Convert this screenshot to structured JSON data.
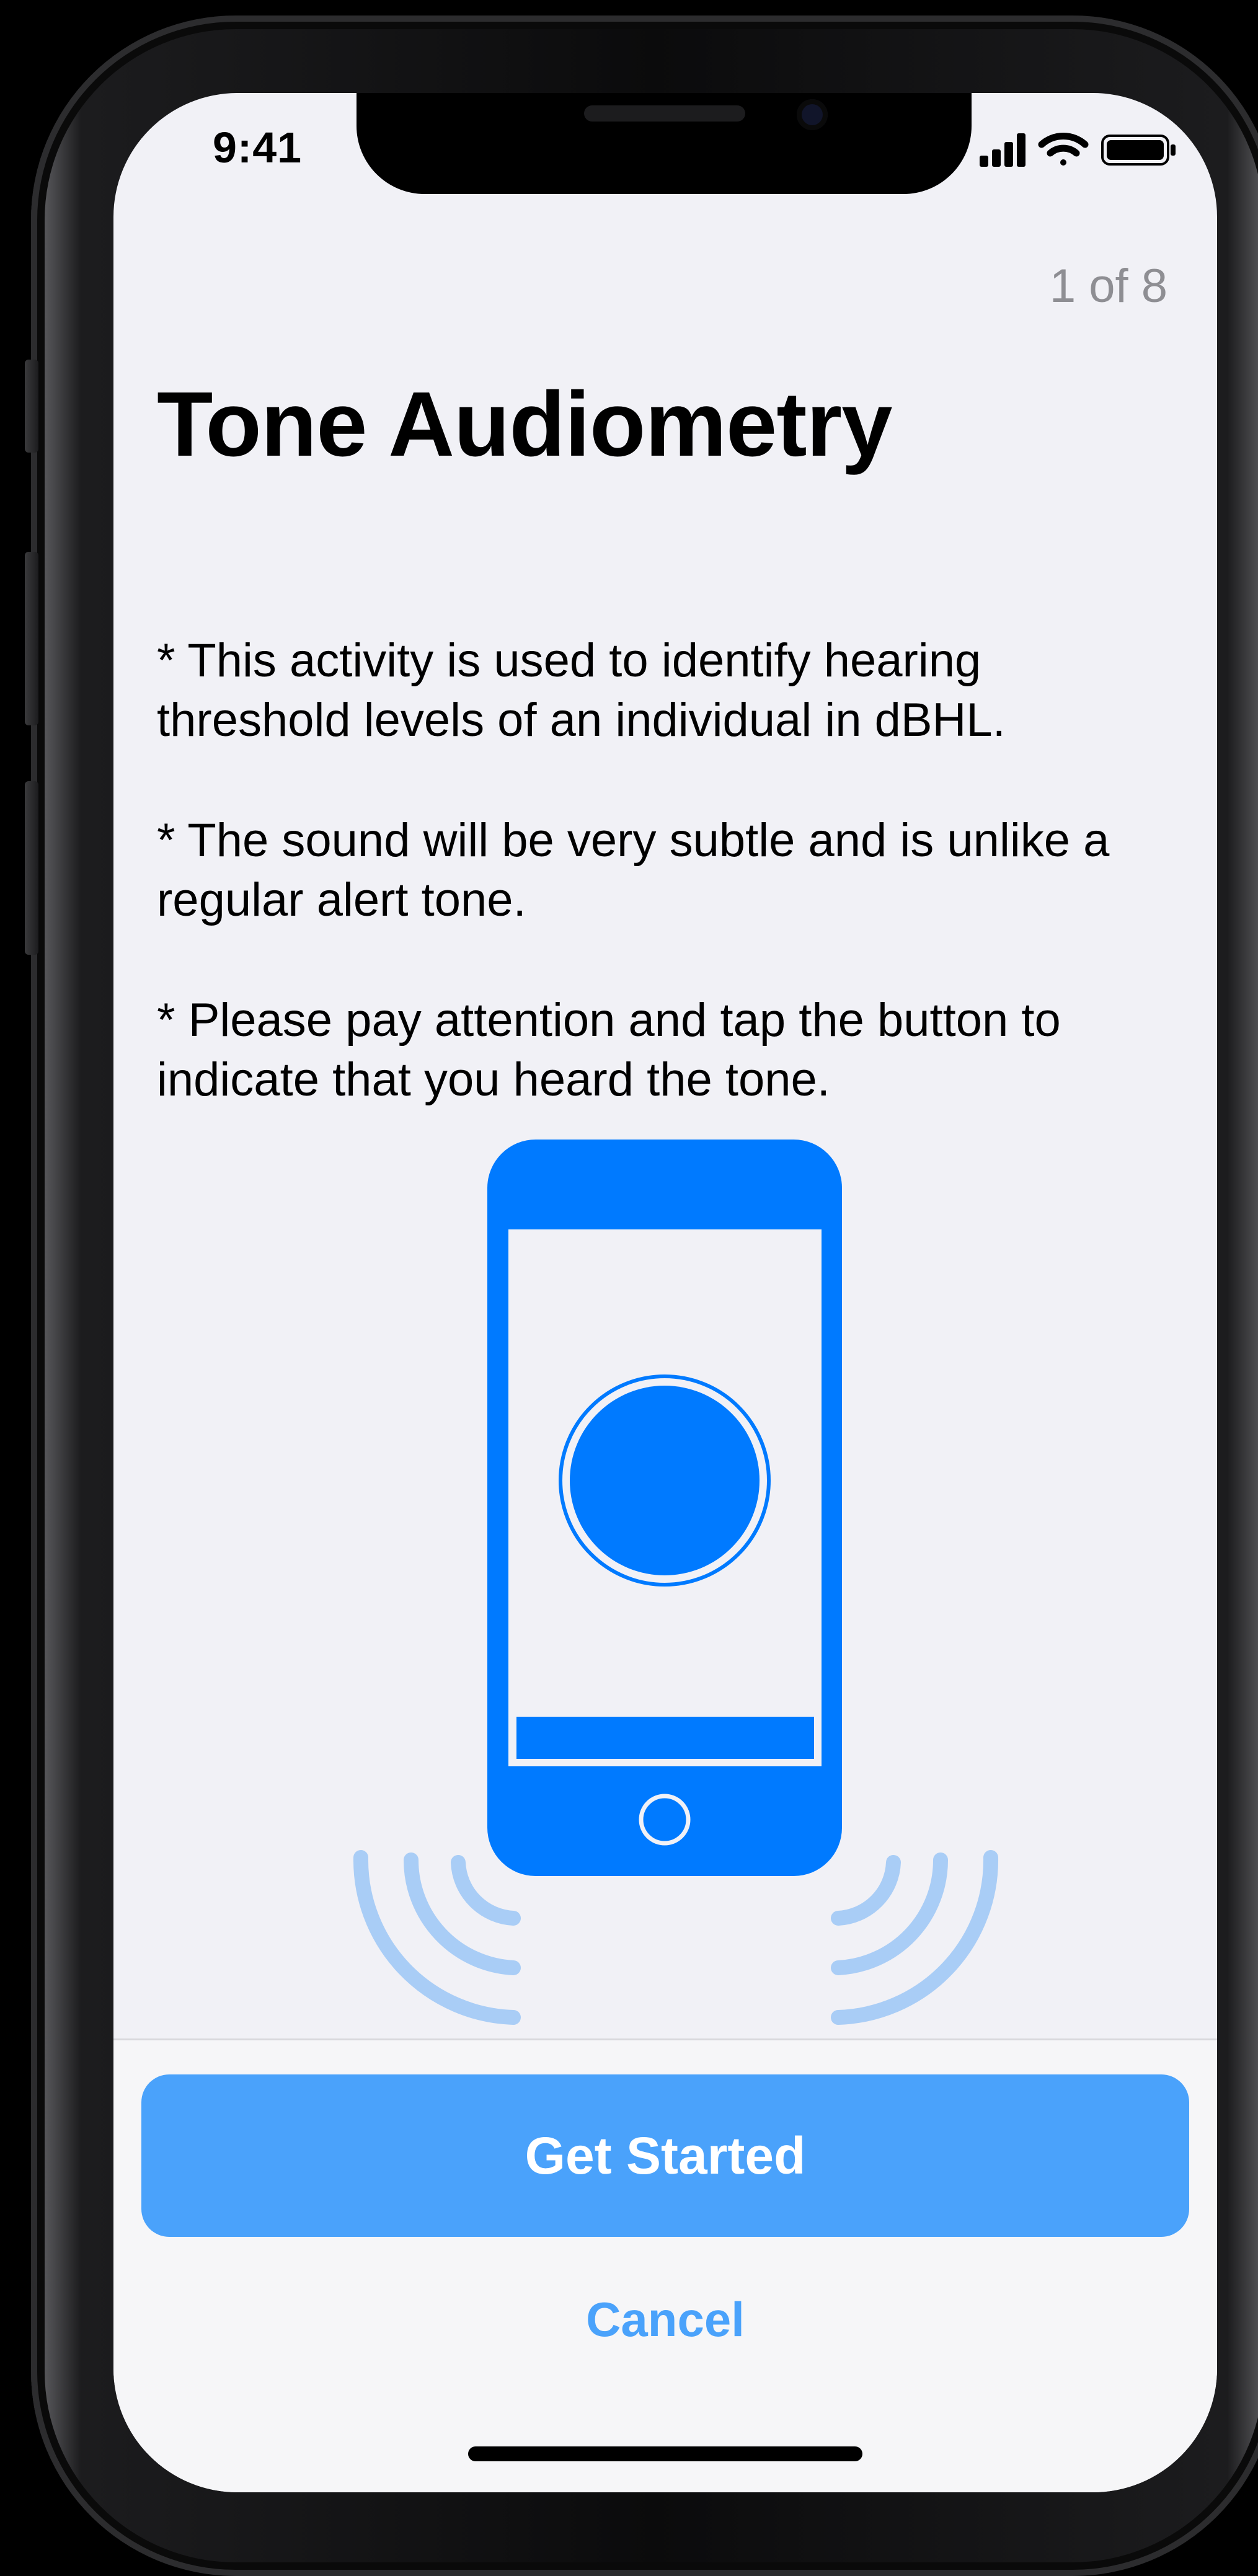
{
  "status_bar": {
    "time": "9:41"
  },
  "onboarding": {
    "step_counter": "1 of 8",
    "title": "Tone Audiometry",
    "bullets": [
      "* This activity is used to identify hearing threshold levels of an individual in dBHL.",
      "* The sound will be very subtle and is unlike a regular alert tone.",
      "* Please pay attention and tap the button to indicate that you heard the tone."
    ]
  },
  "actions": {
    "primary_label": "Get Started",
    "secondary_label": "Cancel"
  },
  "icons": {
    "illustration": "phone-with-sound-waves-icon",
    "signal": "cellular-signal-icon",
    "wifi": "wifi-icon",
    "battery": "battery-icon"
  },
  "colors": {
    "accent": "#007aff",
    "button": "#4aa2fb",
    "wave": "#a9cdf6",
    "background": "#f1f1f6",
    "secondary_text": "#8e8e93"
  }
}
